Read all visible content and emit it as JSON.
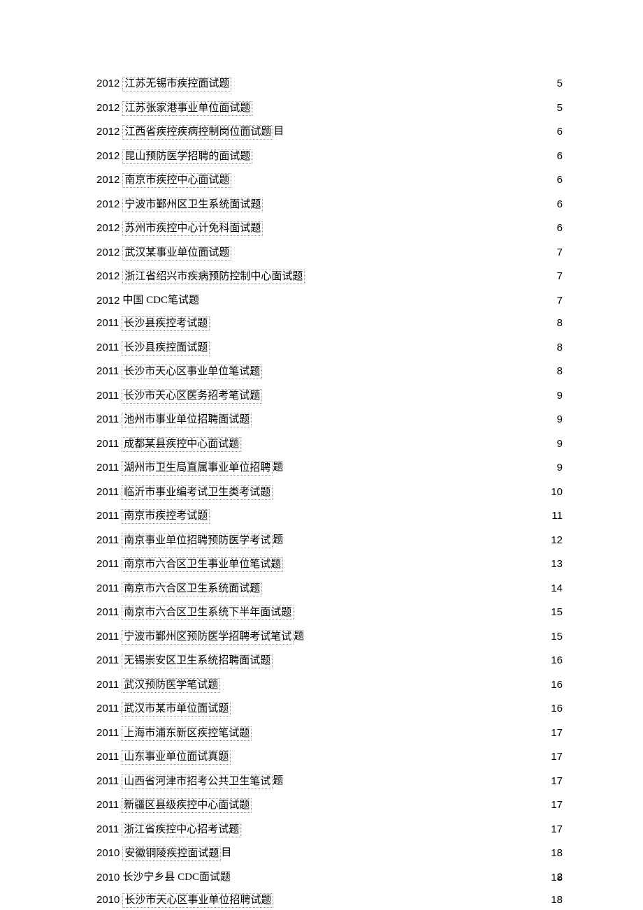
{
  "toc": [
    {
      "year": "2012",
      "boxed": "江苏无锡市疾控面试题",
      "after": "",
      "page": "5"
    },
    {
      "year": "2012",
      "boxed": "江苏张家港事业单位面试题",
      "after": "",
      "page": "5"
    },
    {
      "year": "2012",
      "boxed": "江西省疾控疾病控制岗位面试题",
      "after": "目",
      "page": "6"
    },
    {
      "year": "2012",
      "boxed": "昆山预防医学招聘的面试题",
      "after": "",
      "page": "6"
    },
    {
      "year": "2012",
      "boxed": "南京市疾控中心面试题",
      "after": "",
      "page": "6"
    },
    {
      "year": "2012",
      "boxed": "宁波市鄞州区卫生系统面试题",
      "after": "",
      "page": "6"
    },
    {
      "year": "2012",
      "boxed": "苏州市疾控中心计免科面试题",
      "after": "",
      "page": "6"
    },
    {
      "year": "2012",
      "boxed": "武汉某事业单位面试题",
      "after": "",
      "page": "7"
    },
    {
      "year": "2012",
      "boxed": "浙江省绍兴市疾病预防控制中心面试题",
      "after": "",
      "page": "7"
    },
    {
      "year": "2012",
      "plain": "中国  CDC笔试题",
      "page": "7"
    },
    {
      "year": "2011",
      "boxed": "长沙县疾控考试题",
      "after": "",
      "page": "8"
    },
    {
      "year": "2011",
      "boxed": "长沙县疾控面试题",
      "after": "",
      "page": "8"
    },
    {
      "year": "2011",
      "boxed": "长沙市天心区事业单位笔试题",
      "after": "",
      "page": "8"
    },
    {
      "year": "2011",
      "boxed": "长沙市天心区医务招考笔试题",
      "after": "",
      "page": "9"
    },
    {
      "year": "2011",
      "boxed": "池州市事业单位招聘面试题",
      "after": "",
      "page": "9"
    },
    {
      "year": "2011",
      "boxed": "成都某县疾控中心面试题",
      "after": "",
      "page": "9"
    },
    {
      "year": "2011",
      "boxed": "湖州市卫生局直属事业单位招聘",
      "after": "题",
      "page": "9"
    },
    {
      "year": "2011",
      "boxed": "临沂市事业编考试卫生类考试题",
      "after": "",
      "page": "10"
    },
    {
      "year": "2011",
      "boxed": "南京市疾控考试题",
      "after": "",
      "page": "11"
    },
    {
      "year": "2011",
      "boxed": "南京事业单位招聘预防医学考试",
      "after": "题",
      "page": "12"
    },
    {
      "year": "2011",
      "boxed": "南京市六合区卫生事业单位笔试题",
      "after": "",
      "page": "13"
    },
    {
      "year": "2011",
      "boxed": "南京市六合区卫生系统面试题",
      "after": "",
      "page": "14"
    },
    {
      "year": "2011",
      "boxed": "南京市六合区卫生系统下半年面试题",
      "after": "",
      "page": "15"
    },
    {
      "year": "2011",
      "boxed": "宁波市鄞州区预防医学招聘考试笔试",
      "after": "题",
      "page": "15"
    },
    {
      "year": "2011",
      "boxed": "无锡崇安区卫生系统招聘面试题",
      "after": "",
      "page": "16"
    },
    {
      "year": "2011",
      "boxed": "武汉预防医学笔试题",
      "after": "",
      "page": "16"
    },
    {
      "year": "2011",
      "boxed": "武汉市某市单位面试题",
      "after": "",
      "page": "16"
    },
    {
      "year": "2011",
      "boxed": "上海市浦东新区疾控笔试题",
      "after": "",
      "page": "17"
    },
    {
      "year": "2011",
      "boxed": "山东事业单位面试真题",
      "after": "",
      "page": "17"
    },
    {
      "year": "2011",
      "boxed": "山西省河津市招考公共卫生笔试",
      "after": "题",
      "page": "17"
    },
    {
      "year": "2011",
      "boxed": "新疆区县级疾控中心面试题",
      "after": "",
      "page": "17"
    },
    {
      "year": "2011",
      "boxed": "浙江省疾控中心招考试题",
      "after": "",
      "page": "17"
    },
    {
      "year": "2010",
      "boxed": "安徽铜陵疾控面试题",
      "after": "目",
      "page": "18"
    },
    {
      "year": "2010",
      "plain": "长沙宁乡县  CDC面试题",
      "page": "18"
    },
    {
      "year": "2010",
      "boxed": "长沙市天心区事业单位招聘试题",
      "after": "",
      "page": "18"
    }
  ],
  "footer": {
    "pagenum": "2"
  }
}
